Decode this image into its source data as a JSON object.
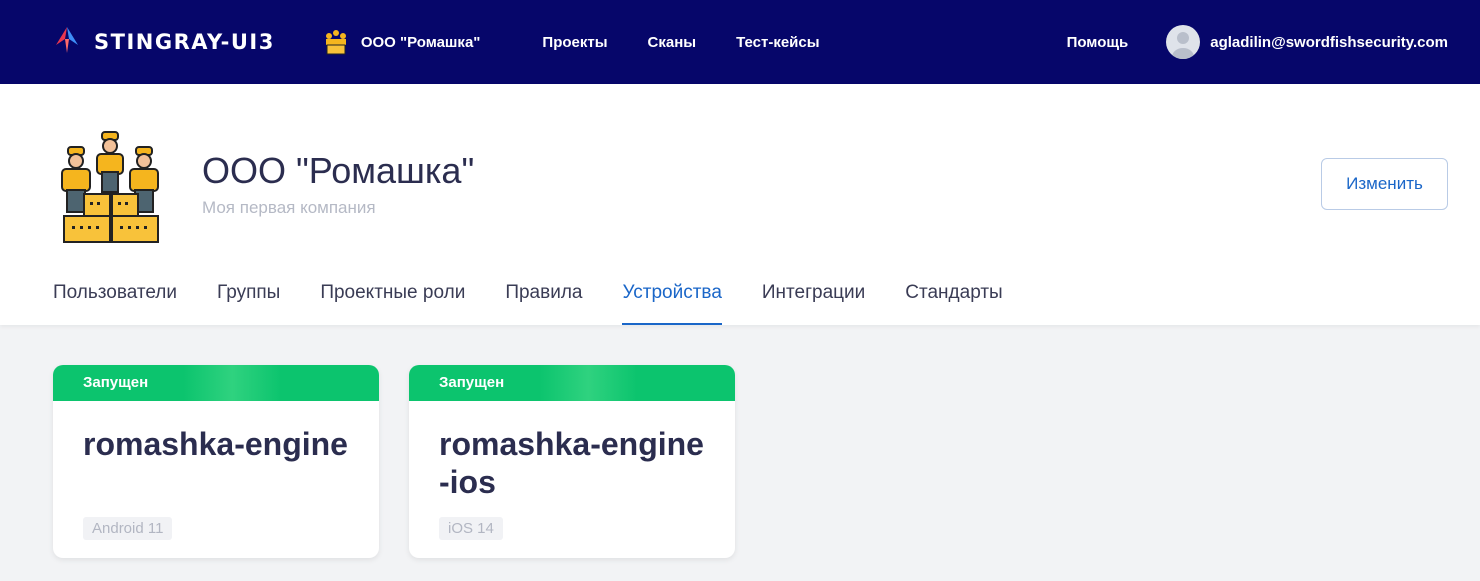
{
  "topbar": {
    "brand": "STINGRAY-UI3",
    "org_name": "ООО \"Ромашка\"",
    "nav": [
      "Проекты",
      "Сканы",
      "Тест-кейсы"
    ],
    "help": "Помощь",
    "user_email": "agladilin@swordfishsecurity.com",
    "bg_color": "#06066a"
  },
  "org": {
    "title": "ООО \"Ромашка\"",
    "subtitle": "Моя первая компания",
    "edit_label": "Изменить"
  },
  "tabs": [
    {
      "label": "Пользователи",
      "active": false
    },
    {
      "label": "Группы",
      "active": false
    },
    {
      "label": "Проектные роли",
      "active": false
    },
    {
      "label": "Правила",
      "active": false
    },
    {
      "label": "Устройства",
      "active": true
    },
    {
      "label": "Интеграции",
      "active": false
    },
    {
      "label": "Стандарты",
      "active": false
    }
  ],
  "devices": [
    {
      "status": "Запущен",
      "name": "romashka-engine",
      "os": "Android 11"
    },
    {
      "status": "Запущен",
      "name": "romashka-engine-ios",
      "os": "iOS 14"
    }
  ],
  "colors": {
    "accent": "#1a66c8",
    "status_green": "#0cc46e"
  }
}
